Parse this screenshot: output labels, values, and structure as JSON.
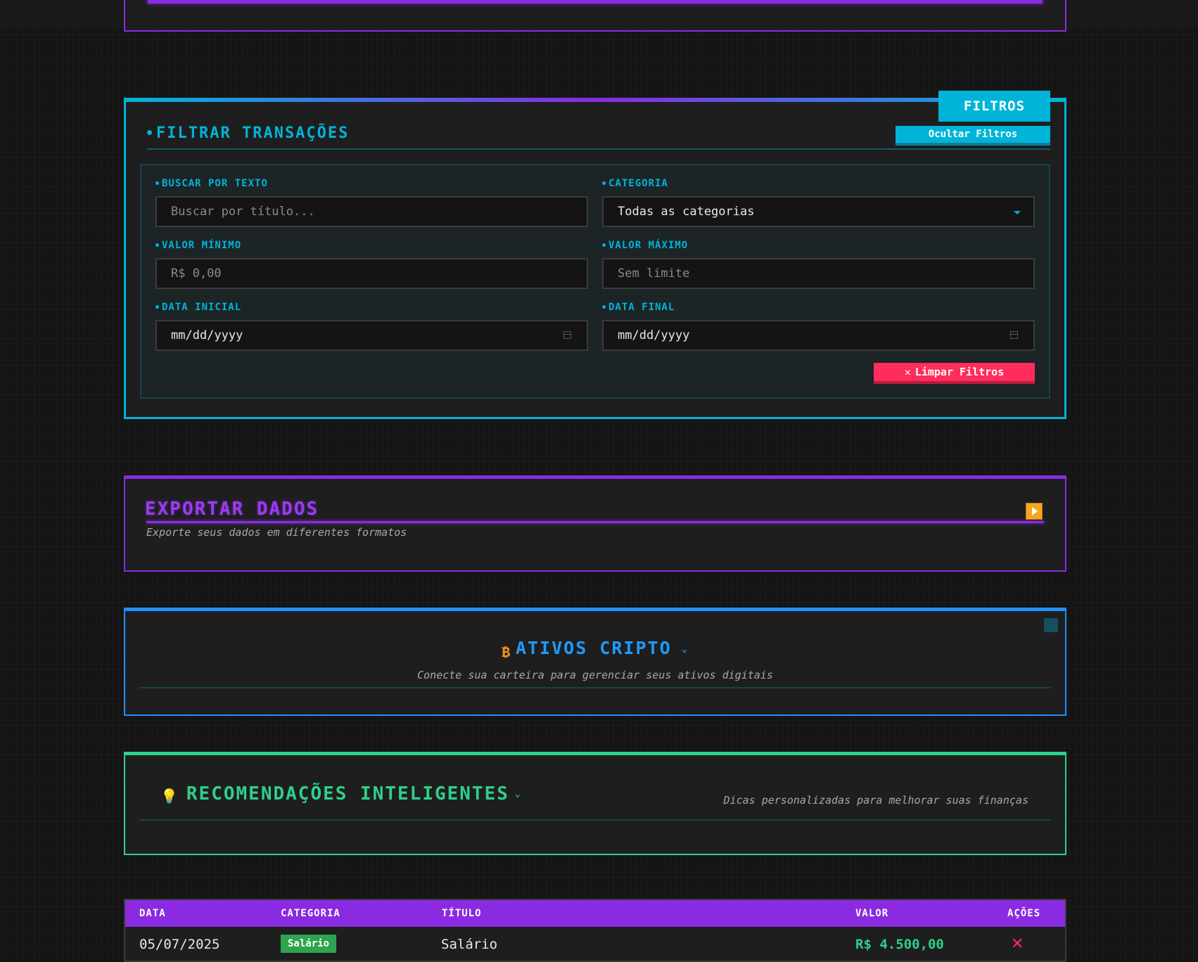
{
  "filters": {
    "badge": "FILTROS",
    "title": "FILTRAR TRANSAÇÕES",
    "hide_button": "Ocultar Filtros",
    "search_label": "BUSCAR POR TEXTO",
    "search_placeholder": "Buscar por título...",
    "category_label": "CATEGORIA",
    "category_value": "Todas as categorias",
    "min_label": "VALOR MÍNIMO",
    "min_placeholder": "R$ 0,00",
    "max_label": "VALOR MÁXIMO",
    "max_placeholder": "Sem limite",
    "start_label": "DATA INICIAL",
    "start_value": "mm/dd/yyyy",
    "end_label": "DATA FINAL",
    "end_value": "mm/dd/yyyy",
    "clear_button": "Limpar Filtros"
  },
  "export": {
    "title": "EXPORTAR DADOS",
    "subtitle": "Exporte seus dados em diferentes formatos"
  },
  "crypto": {
    "icon_glyph": "₿",
    "title": "ATIVOS CRIPTO",
    "subtitle": "Conecte sua carteira para gerenciar seus ativos digitais"
  },
  "recommendations": {
    "icon_glyph": "💡",
    "title": "RECOMENDAÇÕES INTELIGENTES",
    "subtitle": "Dicas personalizadas para melhorar suas finanças"
  },
  "table": {
    "headers": {
      "date": "DATA",
      "category": "CATEGORIA",
      "title": "TÍTULO",
      "value": "VALOR",
      "actions": "AÇÕES"
    },
    "rows": [
      {
        "date": "05/07/2025",
        "category": "Salário",
        "title": "Salário",
        "value": "R$ 4.500,00",
        "action_glyph": "✕"
      }
    ]
  },
  "colors": {
    "accent_purple": "#8a2be2",
    "accent_cyan": "#00b4d8",
    "accent_blue": "#1e90ff",
    "accent_green": "#2ed08a",
    "danger": "#ff2d5a"
  }
}
